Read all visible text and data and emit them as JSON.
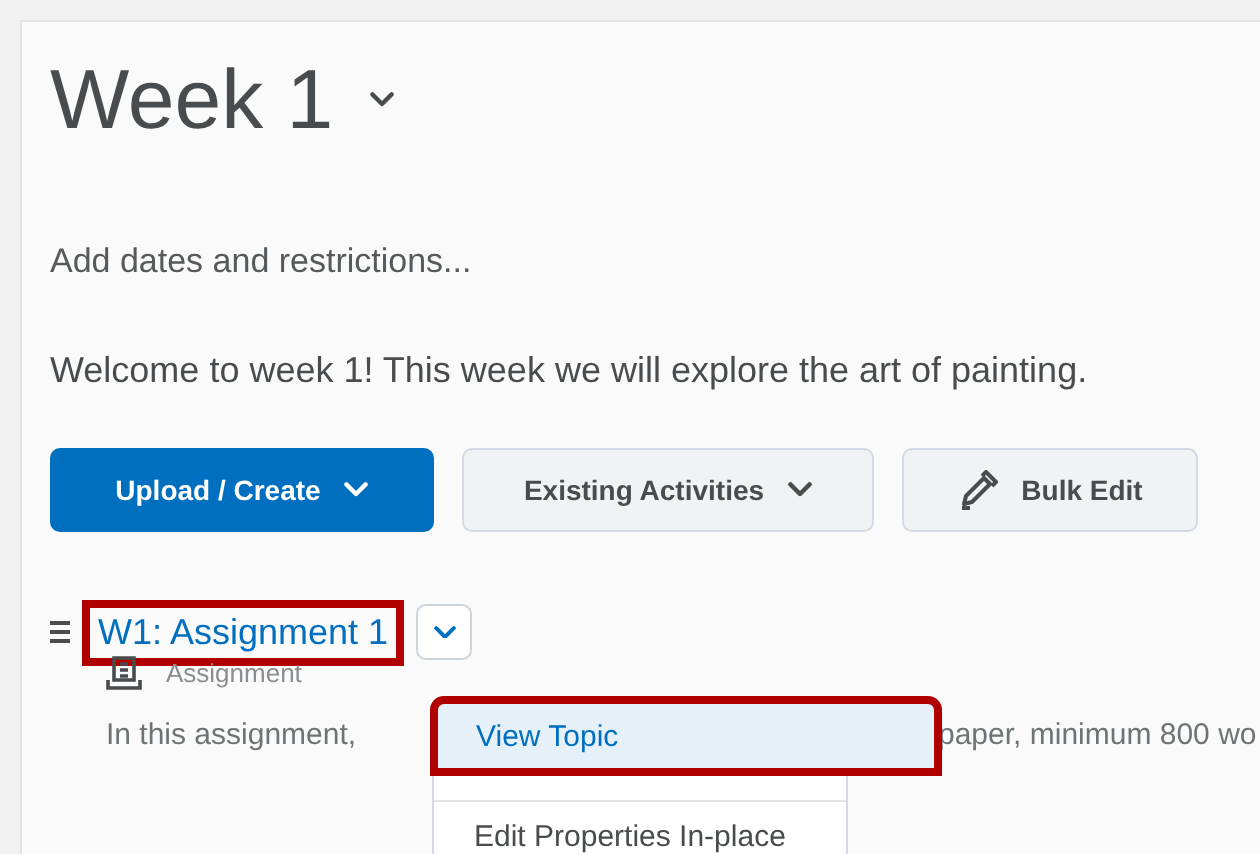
{
  "module": {
    "title": "Week 1",
    "dates_link": "Add dates and restrictions...",
    "description": "Welcome to week 1! This week we will explore the art of painting."
  },
  "buttons": [
    {
      "label": "Upload / Create",
      "kind": "primary",
      "has_menu": true
    },
    {
      "label": "Existing Activities",
      "kind": "secondary",
      "has_menu": true
    },
    {
      "label": "Bulk Edit",
      "kind": "edit",
      "has_menu": false
    }
  ],
  "topic": {
    "title": "W1: Assignment 1",
    "type": "Assignment",
    "highlighted": true,
    "description_parts": [
      "In this assignment,",
      "paper, minimum 800 wo"
    ]
  },
  "context_menu": {
    "items": [
      {
        "label": "View Topic",
        "selected": true,
        "highlighted": true
      },
      {
        "label": "Edit Properties In-place",
        "selected": false,
        "highlighted": false
      }
    ]
  }
}
